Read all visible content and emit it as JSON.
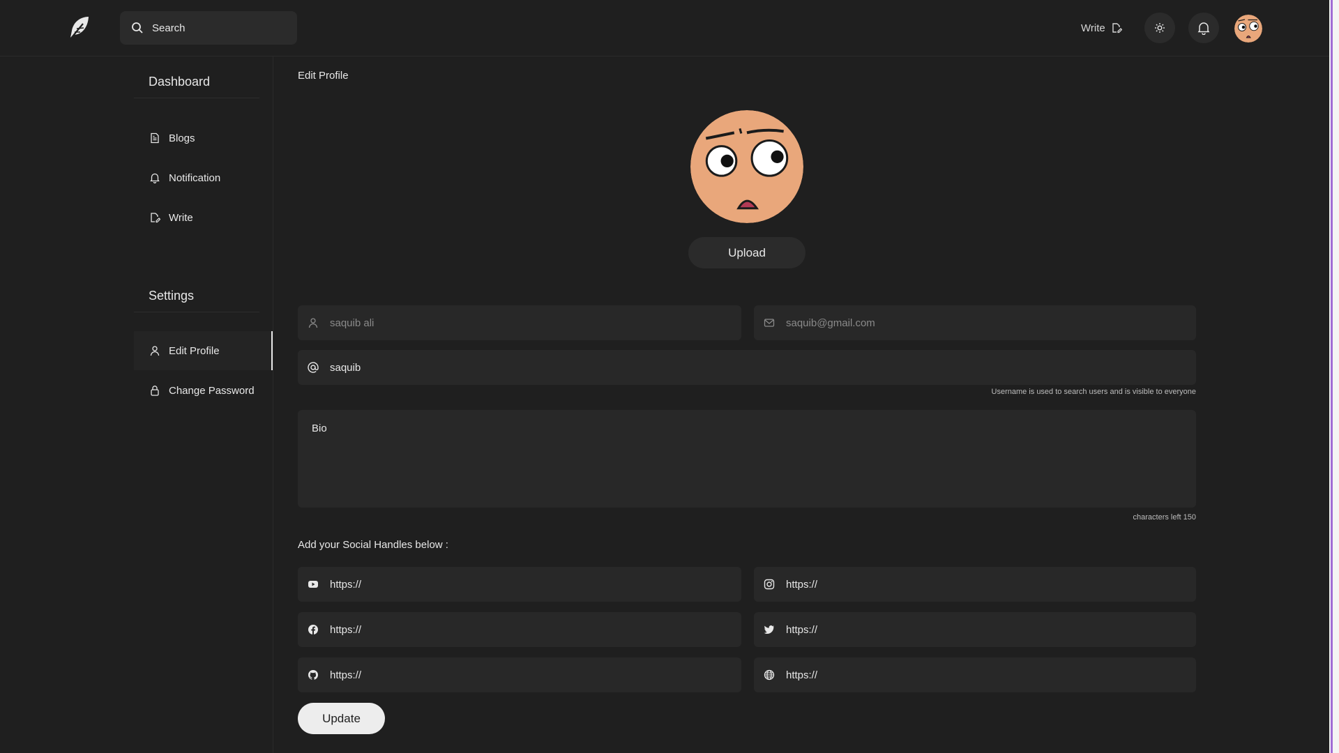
{
  "header": {
    "search_placeholder": "Search",
    "write_label": "Write"
  },
  "sidebar": {
    "dashboard_heading": "Dashboard",
    "dashboard_items": [
      {
        "label": "Blogs",
        "icon": "document-icon"
      },
      {
        "label": "Notification",
        "icon": "bell-icon"
      },
      {
        "label": "Write",
        "icon": "write-icon"
      }
    ],
    "settings_heading": "Settings",
    "settings_items": [
      {
        "label": "Edit Profile",
        "icon": "user-icon",
        "active": true
      },
      {
        "label": "Change Password",
        "icon": "lock-icon",
        "active": false
      }
    ]
  },
  "main": {
    "title": "Edit Profile",
    "upload_label": "Upload",
    "fullname_value": "saquib ali",
    "email_value": "saquib@gmail.com",
    "username_value": "saquib",
    "username_hint": "Username is used to search users and is visible to everyone",
    "bio_placeholder": "Bio",
    "chars_left": "characters left 150",
    "social_title": "Add your Social Handles below :",
    "social": {
      "youtube_placeholder": "https://",
      "instagram_placeholder": "https://",
      "facebook_placeholder": "https://",
      "twitter_placeholder": "https://",
      "github_placeholder": "https://",
      "website_placeholder": "https://"
    },
    "update_label": "Update"
  },
  "colors": {
    "background": "#1f1f1f",
    "field": "#282828",
    "text": "#e8e8e8",
    "avatar_skin": "#e9a77b",
    "scroll_accent": "#a06cd5"
  }
}
